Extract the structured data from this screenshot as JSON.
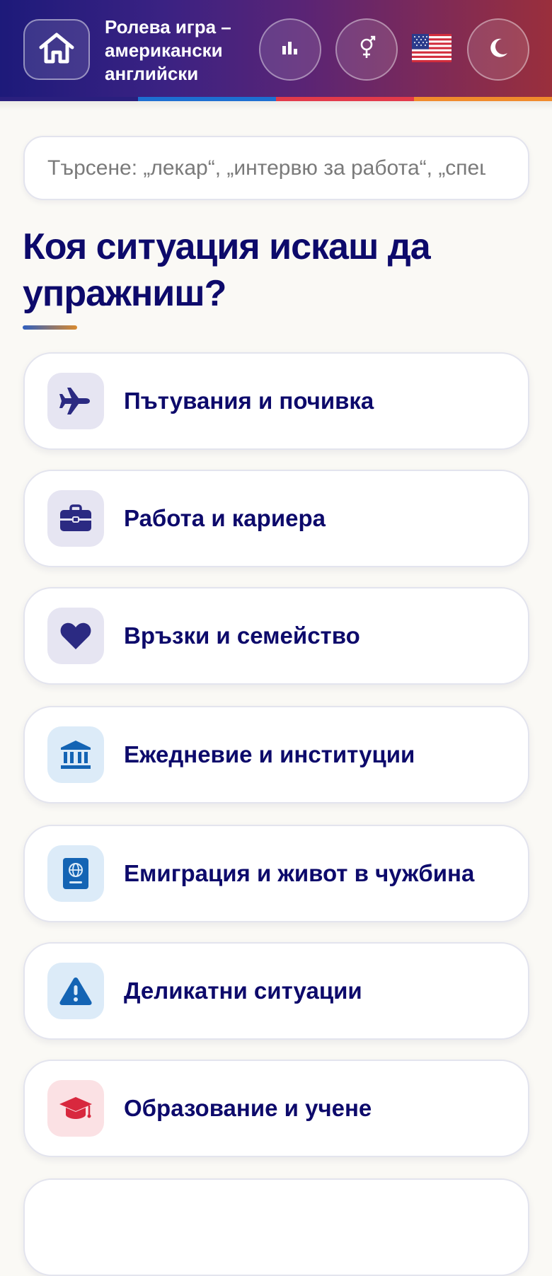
{
  "header": {
    "title": "Ролева игра – американски английски",
    "flag": "🇺🇸",
    "icons": {
      "home": "home-icon",
      "stats": "bar-chart-icon",
      "gender": "gender-icon",
      "theme": "moon-icon"
    },
    "stripe_colors": [
      "#2a1f7e",
      "#1d6fd1",
      "#e23a4a",
      "#f08a2c"
    ]
  },
  "search": {
    "placeholder": "Търсене: „лекар“, „интервю за работа“, „спешен случай“…"
  },
  "main": {
    "heading": "Коя ситуация искаш да упражниш?",
    "categories": [
      {
        "label": "Пътувания и почивка",
        "icon": "airplane-icon",
        "bg": "#e6e5f2",
        "color": "#2b2a82"
      },
      {
        "label": "Работа и кариера",
        "icon": "briefcase-icon",
        "bg": "#e6e5f2",
        "color": "#2b2a82"
      },
      {
        "label": "Връзки и семейство",
        "icon": "heart-icon",
        "bg": "#e6e5f2",
        "color": "#2b2a82"
      },
      {
        "label": "Ежедневие и институции",
        "icon": "bank-icon",
        "bg": "#dcebf8",
        "color": "#1464b4"
      },
      {
        "label": "Емиграция и живот в чужбина",
        "icon": "passport-icon",
        "bg": "#dcebf8",
        "color": "#1464b4"
      },
      {
        "label": "Деликатни ситуации",
        "icon": "warning-icon",
        "bg": "#dcebf8",
        "color": "#1464b4"
      },
      {
        "label": "Образование и учене",
        "icon": "graduation-cap-icon",
        "bg": "#fbe1e4",
        "color": "#d8283e"
      }
    ]
  }
}
